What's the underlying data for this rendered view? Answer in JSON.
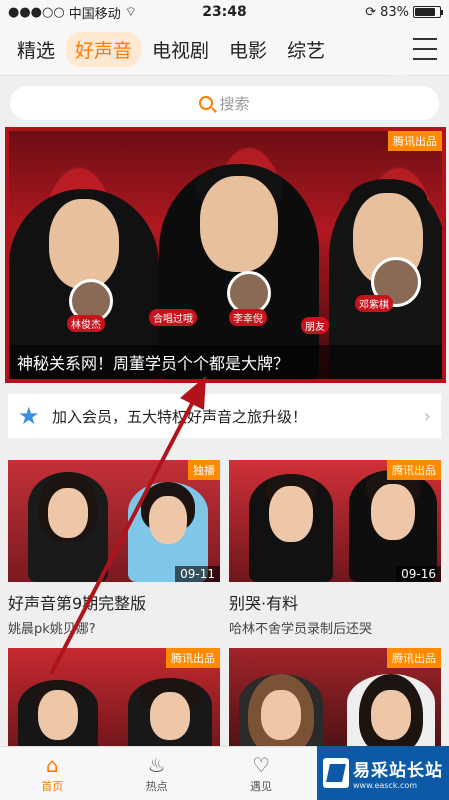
{
  "status_bar": {
    "carrier": "中国移动",
    "time": "23:48",
    "battery": "83%",
    "battery_level": 0.83
  },
  "tabs": [
    {
      "label": "精选",
      "active": false
    },
    {
      "label": "好声音",
      "active": true
    },
    {
      "label": "电视剧",
      "active": false
    },
    {
      "label": "电影",
      "active": false
    },
    {
      "label": "综艺",
      "active": false
    }
  ],
  "search": {
    "placeholder": "搜索"
  },
  "banner": {
    "badge": "腾讯出品",
    "caption": "神秘关系网！周董学员个个都是大牌？",
    "bubble_labels": [
      "林俊杰",
      "李幸倪",
      "邓紫棋",
      "合唱过哦",
      "朋友"
    ]
  },
  "vip": {
    "text": "加入会员，五大特权好声音之旅升级！"
  },
  "cards": [
    {
      "tag": "独播",
      "date": "09-11",
      "title": "好声音第9期完整版",
      "subtitle": "姚晨pk姚贝娜?"
    },
    {
      "tag": "腾讯出品",
      "date": "09-16",
      "title": "别哭·有料",
      "subtitle": "哈林不舍学员录制后还哭"
    },
    {
      "tag": "腾讯出品",
      "date": "",
      "title": "",
      "subtitle": ""
    },
    {
      "tag": "腾讯出品",
      "date": "",
      "title": "",
      "subtitle": ""
    }
  ],
  "bottom_nav": [
    {
      "label": "首页",
      "icon": "home-icon",
      "active": true
    },
    {
      "label": "热点",
      "icon": "flame-icon",
      "active": false
    },
    {
      "label": "遇见",
      "icon": "heart-icon",
      "active": false
    }
  ],
  "watermark": {
    "big": "易采站长站",
    "small": "www.easck.com"
  },
  "colors": {
    "accent": "#ff7a00",
    "banner_border": "#b0141a",
    "arrow": "#b0141a"
  }
}
